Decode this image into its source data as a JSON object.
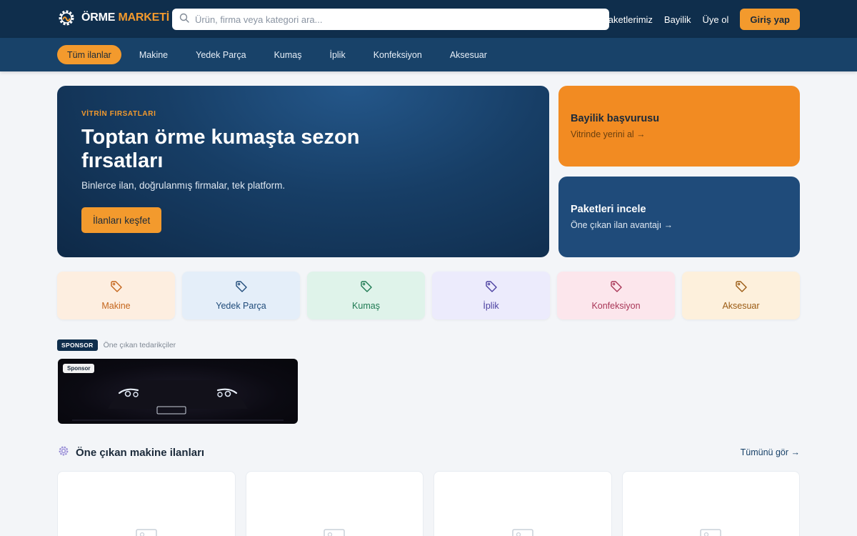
{
  "brand": {
    "word1": "ÖRME",
    "word2": "MARKETİ",
    "accent": "#f39a2d"
  },
  "search": {
    "placeholder": "Ürün, firma veya kategori ara..."
  },
  "topnav": {
    "packages": "Paketlerimiz",
    "dealership": "Bayilik",
    "signup": "Üye ol",
    "login": "Giriş yap"
  },
  "categories_nav": [
    "Tüm ilanlar",
    "Makine",
    "Yedek Parça",
    "Kumaş",
    "İplik",
    "Konfeksiyon",
    "Aksesuar"
  ],
  "hero": {
    "eyebrow": "VİTRİN FIRSATLARI",
    "title": "Toptan örme kumaşta sezon fırsatları",
    "subtitle": "Binlerce ilan, doğrulanmış firmalar, tek platform.",
    "cta": "İlanları keşfet"
  },
  "promo": {
    "dealer": {
      "title": "Bayilik başvurusu",
      "subtitle": "Vitrinde yerini al →"
    },
    "packages": {
      "title": "Paketleri incele",
      "subtitle": "Öne çıkan ilan avantajı →"
    }
  },
  "category_cards": [
    {
      "label": "Makine",
      "bg": "#fdeee0",
      "color": "#c4651b",
      "icon": "tag-icon"
    },
    {
      "label": "Yedek Parça",
      "bg": "#e4eef9",
      "color": "#1f4b7a",
      "icon": "tag-icon"
    },
    {
      "label": "Kumaş",
      "bg": "#dff3ea",
      "color": "#1e7a52",
      "icon": "tag-icon"
    },
    {
      "label": "İplik",
      "bg": "#ecebfc",
      "color": "#4a3fa0",
      "icon": "tag-icon"
    },
    {
      "label": "Konfeksiyon",
      "bg": "#fce6ec",
      "color": "#a83556",
      "icon": "tag-icon"
    },
    {
      "label": "Aksesuar",
      "bg": "#fdf0dc",
      "color": "#9a5a12",
      "icon": "tag-icon"
    }
  ],
  "sponsor": {
    "badge": "SPONSOR",
    "text": "Öne çıkan tedarikçiler",
    "banner_tag": "Sponsor"
  },
  "section": {
    "title": "Öne çıkan makine ilanları",
    "more": "Tümünü gör →",
    "icon": "gear-icon"
  }
}
